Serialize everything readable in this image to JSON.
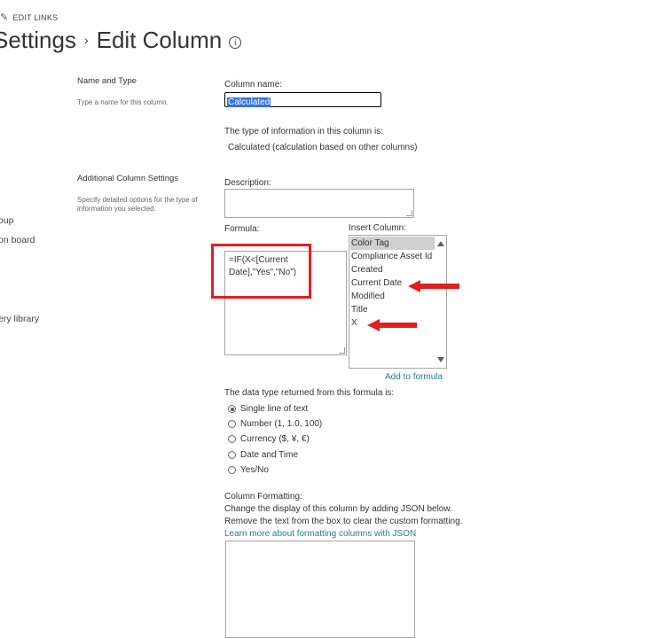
{
  "edit_links": "EDIT LINKS",
  "title": {
    "parent": "Settings",
    "separator": "›",
    "current": "Edit Column",
    "info_icon": "info-icon"
  },
  "left_nav": [
    "oup",
    "on board",
    "ery library"
  ],
  "name_and_type": {
    "heading": "Name and Type",
    "description": "Type a name for this column.",
    "column_name_label": "Column name:",
    "column_name_value": "Calculated",
    "type_info_label": "The type of information in this column is:",
    "type_info_value": "Calculated (calculation based on other columns)"
  },
  "additional_settings": {
    "heading": "Additional Column Settings",
    "description": "Specify detailed options for the type of information you selected.",
    "description_label": "Description:",
    "formula_label": "Formula:",
    "formula_value_line1": "=IF(X<[Current",
    "formula_value_line2": "Date],\"Yes\",\"No\")",
    "insert_column_label": "Insert Column:",
    "insert_columns": [
      "Color Tag",
      "Compliance Asset Id",
      "Created",
      "Current Date",
      "Modified",
      "Title",
      "X"
    ],
    "selected_insert_column": "Color Tag",
    "add_to_formula": "Add to formula",
    "return_type_label": "The data type returned from this formula is:",
    "return_types": [
      "Single line of text",
      "Number (1, 1.0, 100)",
      "Currency ($, ¥, €)",
      "Date and Time",
      "Yes/No"
    ],
    "selected_return_type": "Single line of text",
    "column_formatting_label": "Column Formatting:",
    "column_formatting_desc1": "Change the display of this column by adding JSON below.",
    "column_formatting_desc2": "Remove the text from the box to clear the custom formatting.",
    "column_formatting_link": "Learn more about formatting columns with JSON"
  },
  "annotation_color": "#e02020",
  "selection_color": "#3874d8",
  "link_color": "#2b7b8e"
}
